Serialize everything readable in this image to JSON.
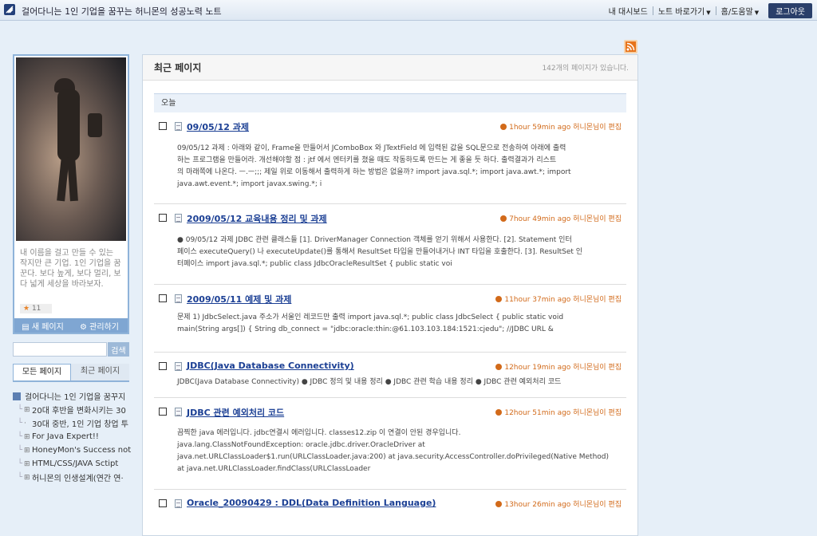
{
  "app": {
    "title": "걸어다니는 1인 기업을 꿈꾸는 허니몬의 성공노력 노트"
  },
  "topnav": {
    "dashboard": "내 대시보드",
    "note_shortcut": "노트 바로가기",
    "home_help": "홈/도움말",
    "logout": "로그아웃"
  },
  "profile": {
    "bio": "내 이름을 걸고 만들 수 있는 작지만 큰 기업. 1인 기업을 꿈꾼다. 보다 높게, 보다 멀리, 보다 넓게 세상을 바라보자.",
    "rating": "11",
    "new_page": "새 페이지",
    "manage": "관리하기"
  },
  "search": {
    "placeholder": "",
    "button": "검색"
  },
  "side_tabs": {
    "all_pages": "모든 페이지",
    "recent_pages": "최근 페이지"
  },
  "tree": {
    "root": "걸어다니는 1인 기업을 꿈꾸지",
    "nodes": [
      {
        "label": "20대 후반을 변화시키는 30",
        "pm": "⊞"
      },
      {
        "label": "30대 중반, 1인 기업 창업 투",
        "pm": "·"
      },
      {
        "label": "For Java Expert!!",
        "pm": "⊞"
      },
      {
        "label": "HoneyMon's Success not",
        "pm": "⊞"
      },
      {
        "label": "HTML/CSS/JAVA Sctipt",
        "pm": "⊞"
      },
      {
        "label": "허니몬의 인생설계(연간 연·",
        "pm": "⊞"
      }
    ]
  },
  "main": {
    "title": "최근 페이지",
    "page_count": "142개의 페이지가 있습니다.",
    "day_label": "오늘"
  },
  "entries": [
    {
      "title": "09/05/12 과제",
      "meta": "1hour 59min ago 허니몬님이 편집",
      "excerpt": [
        "09/05/12 과제 : 아래와 같이, Frame을 만들어서 JComboBox 와 JTextField 에 입력된 값을 SQL문으로 전송하여 아래에 출력",
        "하는 프로그램을 만들어라. 개선해야할 점 : jtf 에서 엔터키를 쳤을 때도 작동하도록 만드는 게 좋을 듯 하다. 출력결과가 리스트",
        "의 마래쪽에 나온다. ㅡ.ㅡ;;; 제일 위로 이동해서 출력하게 하는 방법은 없을까? import java.sql.*; import java.awt.*; import",
        "java.awt.event.*; import javax.swing.*; i"
      ]
    },
    {
      "title": "2009/05/12 교육내용 정리 및 과제",
      "meta": "7hour 49min ago 허니몬님이 편집",
      "excerpt": [
        "● 09/05/12 과제 JDBC 관련 클래스들   [1]. DriverManager Connection 객체를 얻기 위해서 사용한다.   [2]. Statement 인터",
        "페이스 executeQuery() 나 executeUpdate()를 통해서 ResultSet 타입을 만들어내거나 INT 타입을 호출한다.   [3]. ResultSet 인",
        "터페이스 import java.sql.*; public class JdbcOracleResultSet {      public static voi"
      ]
    },
    {
      "title": "2009/05/11 예제 및 과제",
      "meta": "11hour 37min ago 허니몬님이 편집",
      "excerpt": [
        "문제 1) JdbcSelect.java 주소가 서울인 레코드만 출력 import java.sql.*; public class JdbcSelect {      public static void",
        "main(String args[]) {          String db_connect = \"jdbc:oracle:thin:@61.103.103.184:1521:cjedu\";  //JDBC URL        &"
      ]
    },
    {
      "title": "JDBC(Java Database Connectivity)",
      "meta": "12hour 19min ago 허니몬님이 편집",
      "excerpt": [
        "JDBC(Java Database Connectivity) ● JDBC 정의 및 내용 정리 ● JDBC 관련 학습 내용 정리 ● JDBC 관련 예외처리 코드"
      ]
    },
    {
      "title": "JDBC 관련 예외처리 코드",
      "meta": "12hour 51min ago 허니몬님이 편집",
      "excerpt": [
        "끔찍한 java 에러입니다. jdbc연결시 에러입니다. classes12.zip 이 연결이 안된 경우입니다.",
        "java.lang.ClassNotFoundException: oracle.jdbc.driver.OracleDriver at",
        "java.net.URLClassLoader$1.run(URLClassLoader.java:200) at java.security.AccessController.doPrivileged(Native Method)",
        "at java.net.URLClassLoader.findClass(URLClassLoader"
      ]
    },
    {
      "title": "Oracle_20090429 : DDL(Data Definition Language)",
      "meta": "13hour 26min ago 허니몬님이 편집",
      "excerpt": []
    }
  ],
  "colors": {
    "accent": "#1b3f94",
    "meta": "#d26a1a",
    "logout_bg": "#2a3f6a"
  }
}
